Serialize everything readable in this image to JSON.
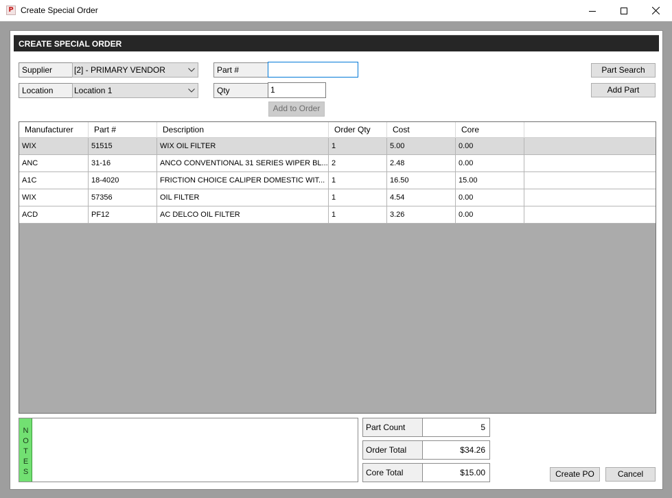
{
  "window": {
    "title": "Create Special Order",
    "app_icon_letter": "P"
  },
  "panel": {
    "header": "CREATE SPECIAL ORDER"
  },
  "form": {
    "supplier_label": "Supplier",
    "supplier_value": "[2] - PRIMARY VENDOR",
    "location_label": "Location",
    "location_value": "Location 1",
    "part_label": "Part #",
    "part_value": "",
    "qty_label": "Qty",
    "qty_value": "1",
    "add_to_order": "Add to Order",
    "part_search": "Part Search",
    "add_part": "Add Part"
  },
  "grid": {
    "columns": [
      "Manufacturer",
      "Part #",
      "Description",
      "Order Qty",
      "Cost",
      "Core"
    ],
    "rows": [
      {
        "manufacturer": "WIX",
        "part": "51515",
        "description": "WIX OIL FILTER",
        "qty": "1",
        "cost": "5.00",
        "core": "0.00"
      },
      {
        "manufacturer": "ANC",
        "part": "31-16",
        "description": "ANCO CONVENTIONAL 31 SERIES WIPER BL...",
        "qty": "2",
        "cost": "2.48",
        "core": "0.00"
      },
      {
        "manufacturer": "A1C",
        "part": "18-4020",
        "description": "FRICTION CHOICE CALIPER DOMESTIC WIT...",
        "qty": "1",
        "cost": "16.50",
        "core": "15.00"
      },
      {
        "manufacturer": "WIX",
        "part": "57356",
        "description": "OIL FILTER",
        "qty": "1",
        "cost": "4.54",
        "core": "0.00"
      },
      {
        "manufacturer": "ACD",
        "part": "PF12",
        "description": "AC DELCO OIL FILTER",
        "qty": "1",
        "cost": "3.26",
        "core": "0.00"
      }
    ]
  },
  "notes": {
    "tab_letters": [
      "N",
      "O",
      "T",
      "E",
      "S"
    ],
    "text": ""
  },
  "summary": {
    "part_count_label": "Part Count",
    "part_count": "5",
    "order_total_label": "Order Total",
    "order_total": "$34.26",
    "core_total_label": "Core Total",
    "core_total": "$15.00"
  },
  "footer": {
    "create_po": "Create PO",
    "cancel": "Cancel"
  },
  "colors": {
    "header_bar": "#262626",
    "notes_tab": "#72e072",
    "focus_border": "#0078d7",
    "grid_empty": "#ababab"
  }
}
